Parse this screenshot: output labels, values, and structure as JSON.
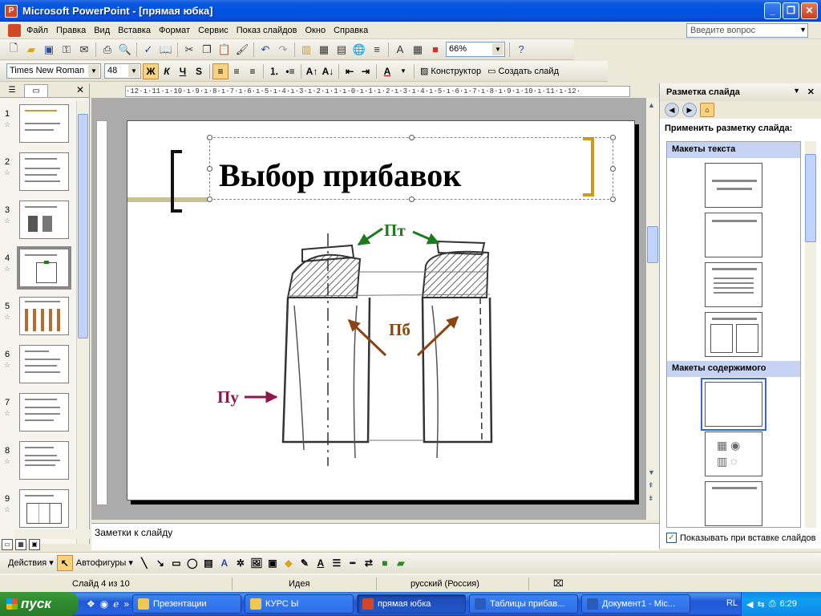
{
  "window": {
    "title": "Microsoft PowerPoint - [прямая юбка]",
    "buttons": [
      "_",
      "❐",
      "✕"
    ]
  },
  "menu": {
    "items": [
      "Файл",
      "Правка",
      "Вид",
      "Вставка",
      "Формат",
      "Сервис",
      "Показ слайдов",
      "Окно",
      "Справка"
    ],
    "help_placeholder": "Введите вопрос"
  },
  "standard_toolbar": {
    "zoom": "66%"
  },
  "format_toolbar": {
    "font_name": "Times New Roman",
    "font_size": "48",
    "bold": "Ж",
    "italic": "К",
    "underline": "Ч",
    "shadow": "S",
    "designer_label": "Конструктор",
    "new_slide_label": "Создать слайд"
  },
  "slides_pane": {
    "thumbnails": [
      {
        "num": "1"
      },
      {
        "num": "2"
      },
      {
        "num": "3"
      },
      {
        "num": "4"
      },
      {
        "num": "5"
      },
      {
        "num": "6"
      },
      {
        "num": "7"
      },
      {
        "num": "8"
      },
      {
        "num": "9"
      }
    ],
    "selected": "4"
  },
  "ruler": {
    "h_text": "·12·ı·11·ı·10·ı·9·ı·8·ı·7·ı·6·ı·5·ı·4·ı·3·ı·2·ı·1·ı·0·ı·1·ı·2·ı·3·ı·4·ı·5·ı·6·ı·7·ı·8·ı·9·ı·10·ı·11·ı·12·"
  },
  "slide": {
    "title": "Выбор прибавок",
    "label_pt": "Пт",
    "label_pb": "Пб",
    "label_pu": "Пу",
    "colors": {
      "pt": "#1F7A1F",
      "pb": "#8B4513",
      "pu": "#8B1A4A",
      "bracket_gold": "#CC9A1E"
    }
  },
  "notes": {
    "placeholder": "Заметки к слайду"
  },
  "task_pane": {
    "title": "Разметка слайда",
    "apply_label": "Применить разметку слайда:",
    "section_text": "Макеты текста",
    "section_content": "Макеты содержимого",
    "show_on_insert": "Показывать при вставке слайдов"
  },
  "draw_toolbar": {
    "actions": "Действия",
    "autoshapes": "Автофигуры"
  },
  "status": {
    "slide": "Слайд 4 из 10",
    "design": "Идея",
    "language": "русский (Россия)"
  },
  "taskbar": {
    "start": "пуск",
    "tasks": [
      "Презентации",
      "КУРС Ы",
      "прямая юбка",
      "Таблицы прибав...",
      "Документ1 - Mic..."
    ],
    "active": "прямая юбка",
    "lang": "RL",
    "time": "6:29"
  }
}
